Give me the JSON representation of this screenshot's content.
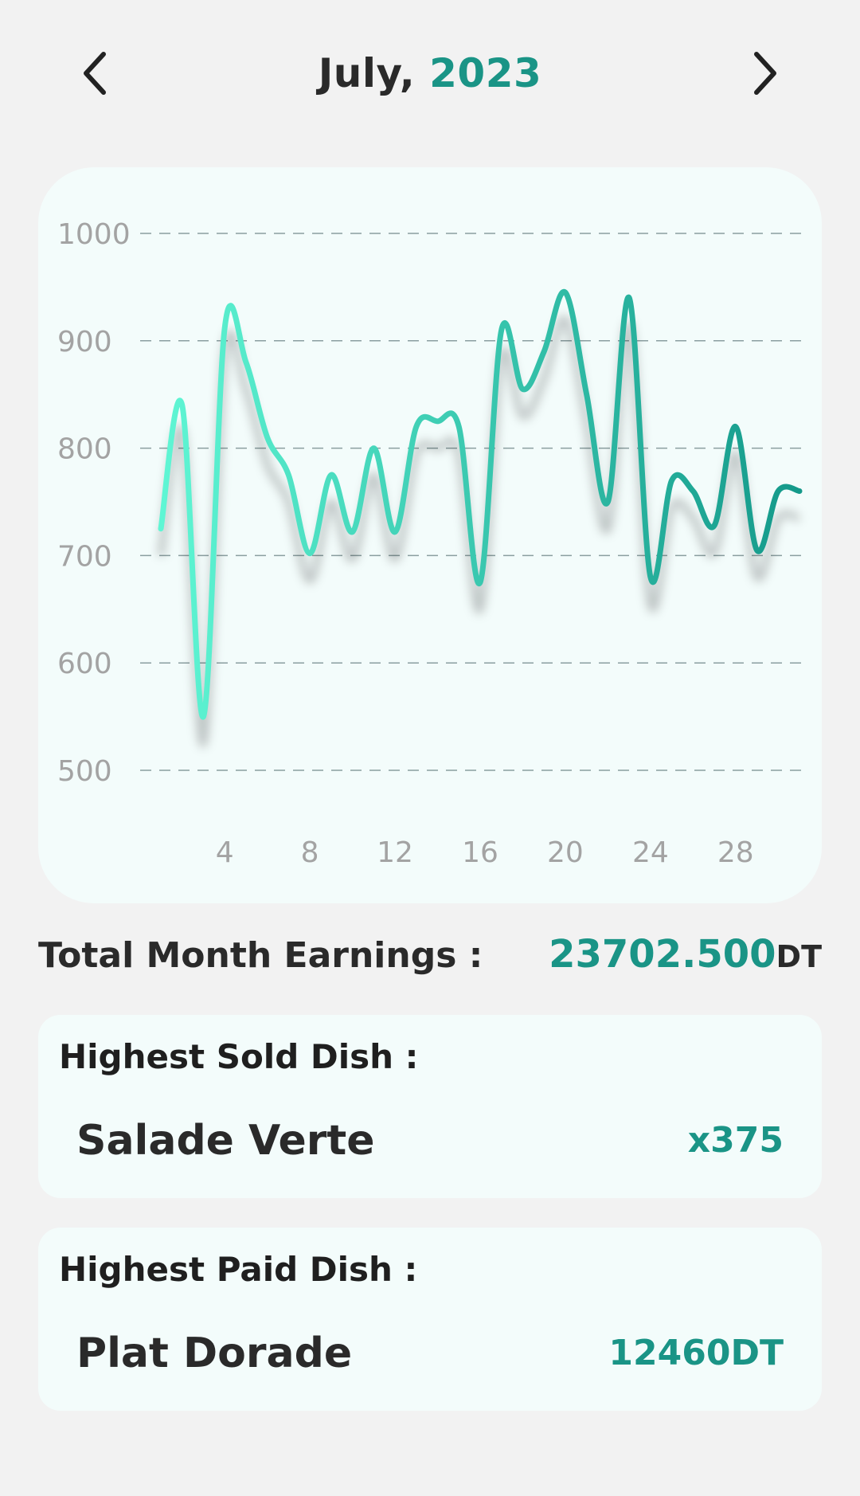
{
  "header": {
    "month": "July, ",
    "year": "2023",
    "prev_icon": "chevron-left-icon",
    "next_icon": "chevron-right-icon"
  },
  "chart_data": {
    "type": "line",
    "title": "",
    "xlabel": "",
    "ylabel": "",
    "ylim": [
      500,
      1000
    ],
    "yticks": [
      1000,
      900,
      800,
      700,
      600,
      500
    ],
    "xlim": [
      1,
      31
    ],
    "xticks": [
      4,
      8,
      12,
      16,
      20,
      24,
      28
    ],
    "grid": true,
    "grid_style": "dashed",
    "line_color_start": "#5ff6d4",
    "line_color_end": "#14998a",
    "series": [
      {
        "x": [
          1,
          2,
          3,
          4,
          5,
          6,
          7,
          8,
          9,
          10,
          11,
          12,
          13,
          14,
          15,
          16,
          17,
          18,
          19,
          20,
          21,
          22,
          23,
          24,
          25,
          26,
          27,
          28,
          29,
          30,
          31
        ],
        "values": [
          725,
          840,
          550,
          912,
          880,
          810,
          775,
          702,
          775,
          722,
          800,
          722,
          820,
          825,
          820,
          675,
          910,
          855,
          890,
          945,
          850,
          750,
          940,
          680,
          770,
          760,
          728,
          820,
          705,
          760,
          760
        ]
      }
    ]
  },
  "earnings": {
    "label": "Total Month Earnings :",
    "amount": "23702.500",
    "unit": "DT"
  },
  "highest_sold": {
    "title": "Highest Sold Dish :",
    "dish": "Salade Verte",
    "stat": "x375"
  },
  "highest_paid": {
    "title": "Highest Paid Dish :",
    "dish": "Plat Dorade",
    "stat": "12460DT"
  }
}
